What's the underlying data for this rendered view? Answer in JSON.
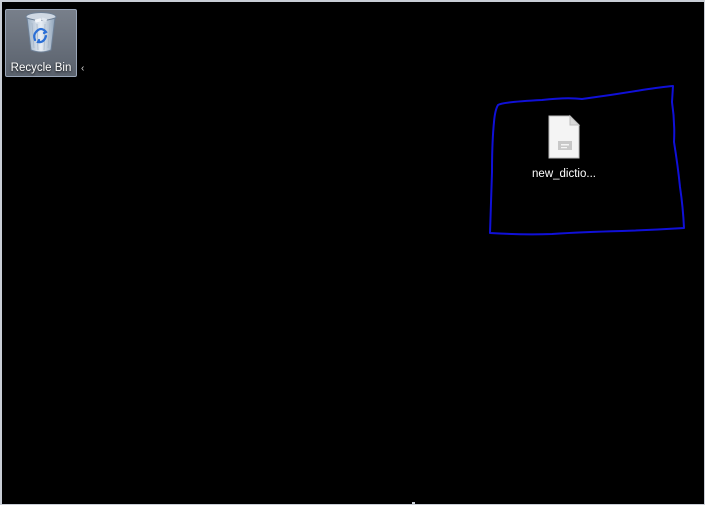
{
  "desktop": {
    "background_color": "#000000",
    "annotation_color": "#1010d8",
    "icons": [
      {
        "label": "Recycle Bin",
        "icon": "recycle-bin-icon",
        "selected": true
      },
      {
        "label": "new_dictio...",
        "icon": "text-file-icon",
        "selected": false
      }
    ],
    "stray_text": "‹"
  }
}
